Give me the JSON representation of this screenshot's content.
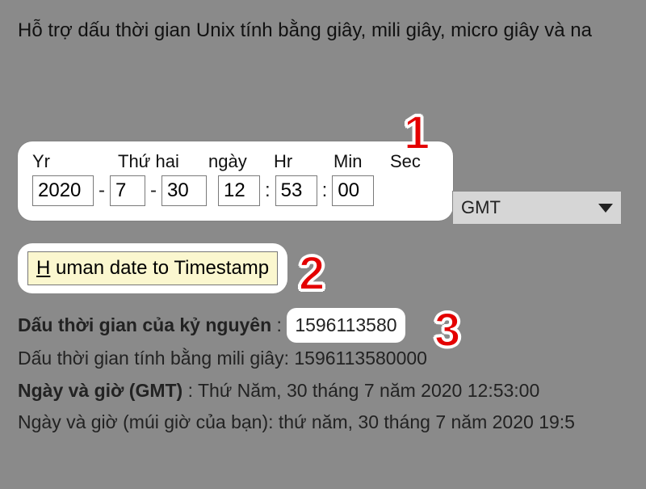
{
  "intro": "Hỗ trợ dấu thời gian Unix tính bằng giây, mili giây, micro giây và na",
  "panel": {
    "labels": {
      "year": "Yr",
      "month": "Thứ hai",
      "day": "ngày",
      "hour": "Hr",
      "minute": "Min",
      "second": "Sec"
    },
    "values": {
      "year": "2020",
      "month": "7",
      "day": "30",
      "hour": "12",
      "minute": "53",
      "second": "00"
    },
    "timezone": "GMT"
  },
  "button": {
    "underline": "H",
    "rest": " uman date to Timestamp"
  },
  "results": {
    "epoch_label": "Dấu thời gian của kỷ nguyên",
    "epoch_value": "1596113580",
    "ms_line": "Dấu thời gian tính bằng mili giây: 1596113580000",
    "gmt_label": "Ngày và giờ (GMT)",
    "gmt_value": ": Thứ Năm, 30 tháng 7 năm 2020 12:53:00",
    "local_line": "Ngày và giờ (múi giờ của bạn): thứ năm, 30 tháng 7 năm 2020 19:5"
  },
  "steps": {
    "one": "1",
    "two": "2",
    "three": "3"
  }
}
